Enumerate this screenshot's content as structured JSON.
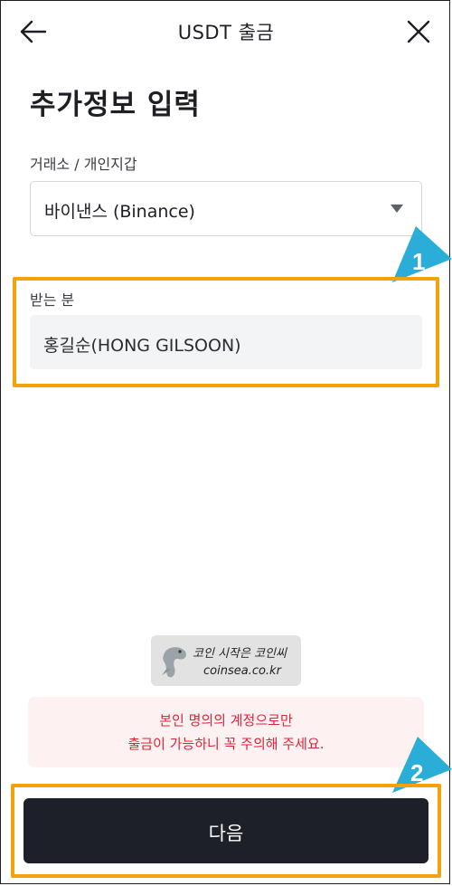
{
  "header": {
    "title": "USDT 출금",
    "back_icon": "arrow-left-icon",
    "close_icon": "close-icon"
  },
  "page_title": "추가정보 입력",
  "exchange": {
    "label": "거래소 / 개인지갑",
    "selected": "바이낸스 (Binance)",
    "dropdown_icon": "chevron-down-icon"
  },
  "recipient": {
    "label": "받는 분",
    "value": "홍길순(HONG GILSOON)"
  },
  "callouts": [
    {
      "number": "1"
    },
    {
      "number": "2"
    }
  ],
  "watermark": {
    "line1": "코인 시작은 코인씨",
    "line2": "coinsea.co.kr"
  },
  "notice": {
    "line1": "본인 명의의 계정으로만",
    "line2": "출금이 가능하니 꼭 주의해 주세요."
  },
  "next_button": {
    "label": "다음"
  },
  "colors": {
    "highlight": "#f5a20a",
    "callout": "#2aaed8",
    "notice_text": "#e0243a",
    "button_bg": "#1d2029"
  }
}
